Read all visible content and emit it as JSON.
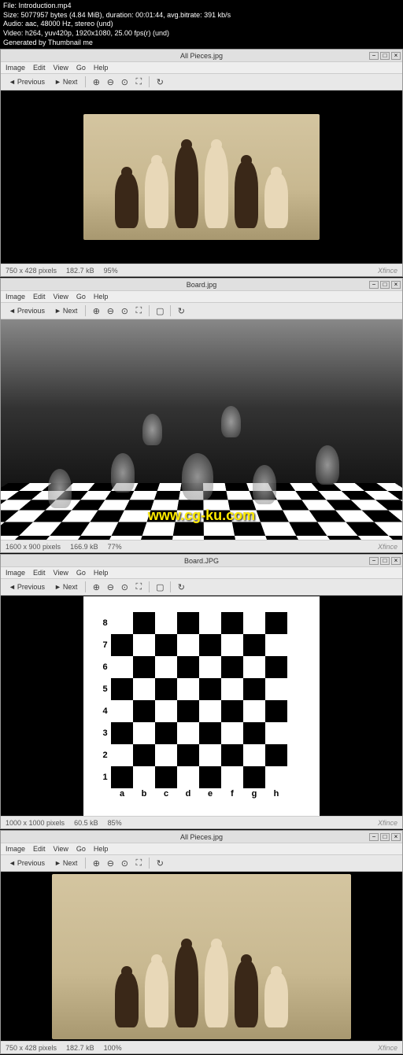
{
  "fileinfo": {
    "l1": "File: Introduction.mp4",
    "l2": "Size: 5077957 bytes (4.84 MiB), duration: 00:01:44, avg.bitrate: 391 kb/s",
    "l3": "Audio: aac, 48000 Hz, stereo (und)",
    "l4": "Video: h264, yuv420p, 1920x1080, 25.00 fps(r) (und)",
    "l5": "Generated by Thumbnail me"
  },
  "menus": {
    "image": "Image",
    "edit": "Edit",
    "view": "View",
    "go": "Go",
    "help": "Help"
  },
  "toolbar": {
    "previous": "Previous",
    "next": "Next"
  },
  "windows": [
    {
      "title": "All Pieces.jpg",
      "status_dims": "750 x 428 pixels",
      "status_size": "182.7 kB",
      "status_zoom": "95%",
      "viewer": "Xfince"
    },
    {
      "title": "Board.jpg",
      "status_dims": "1600 x 900 pixels",
      "status_size": "166.9 kB",
      "status_zoom": "77%",
      "viewer": "Xfince"
    },
    {
      "title": "Board.JPG",
      "status_dims": "1000 x 1000 pixels",
      "status_size": "60.5 kB",
      "status_zoom": "85%",
      "viewer": "Xfince"
    },
    {
      "title": "All Pieces.jpg",
      "status_dims": "750 x 428 pixels",
      "status_size": "182.7 kB",
      "status_zoom": "100%",
      "viewer": "Xfince"
    }
  ],
  "watermark": "www.cg-ku.com",
  "board_rows": [
    "8",
    "7",
    "6",
    "5",
    "4",
    "3",
    "2",
    "1"
  ],
  "board_cols": [
    "a",
    "b",
    "c",
    "d",
    "e",
    "f",
    "g",
    "h"
  ]
}
